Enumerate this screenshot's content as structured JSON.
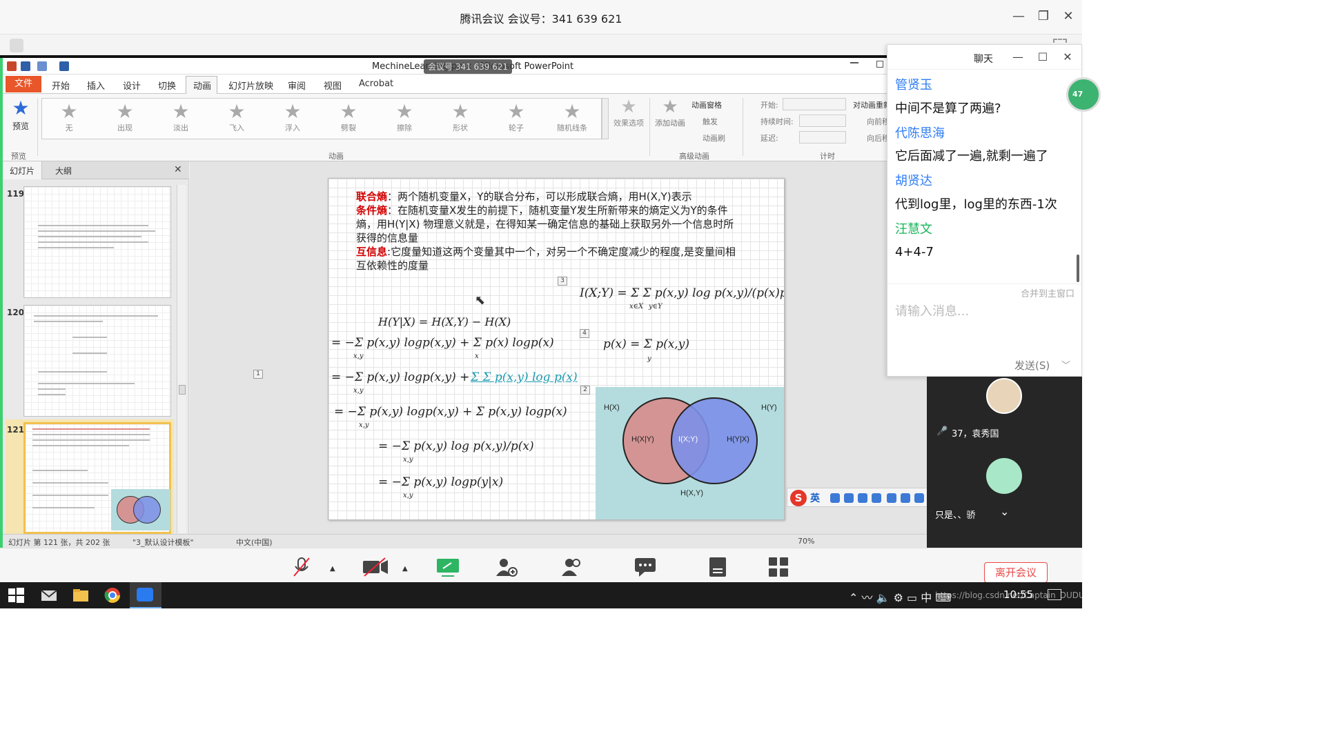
{
  "window": {
    "title": "腾讯会议 会议号：341 639 621"
  },
  "ppt": {
    "doc_title": "MechineLearning.pptx - Microsoft PowerPoint",
    "meeting_overlay": "会议号 341 639 621",
    "menu": [
      "文件",
      "开始",
      "插入",
      "设计",
      "切换",
      "动画",
      "幻灯片放映",
      "审阅",
      "视图",
      "Acrobat"
    ],
    "ribbon": {
      "preview": "预览",
      "preview_group": "预览",
      "animations": [
        "无",
        "出现",
        "淡出",
        "飞入",
        "浮入",
        "劈裂",
        "擦除",
        "形状",
        "轮子",
        "随机线条"
      ],
      "effect_options": "效果选项",
      "animation_group": "动画",
      "add_animation": "添加动画",
      "animation_pane": "动画窗格",
      "trigger": "触发",
      "painter": "动画刷",
      "advanced_group": "高级动画",
      "start": "开始:",
      "duration": "持续时间:",
      "delay": "延迟:",
      "timing_group": "计时",
      "reorder": "对动画重新排序",
      "forward": "向前移动",
      "backward": "向后移动"
    },
    "pane_tabs": [
      "幻灯片",
      "大纲"
    ],
    "thumbnails": [
      {
        "no": "119"
      },
      {
        "no": "120"
      },
      {
        "no": "121"
      }
    ],
    "status": {
      "slide_info": "幻灯片 第 121 张，共 202 张",
      "theme": "\"3_默认设计模板\"",
      "language": "中文(中国)",
      "zoom": "70%"
    }
  },
  "slide": {
    "joint_term": "联合熵",
    "joint_text": "：两个随机变量X，Y的联合分布，可以形成联合熵，用H(X,Y)表示",
    "cond_term": "条件熵",
    "cond_text": "：在随机变量X发生的前提下，随机变量Y发生所新带来的熵定义为Y的条件熵，用H(Y|X) 物理意义就是，在得知某一确定信息的基础上获取另外一个信息时所获得的信息量",
    "mi_term": "互信息",
    "mi_text": ":它度量知道这两个变量其中一个，对另一个不确定度减少的程度,是变量间相互依赖性的度量",
    "badges": [
      "1",
      "2",
      "3",
      "4"
    ],
    "eq_mi": "I(X;Y) = Σ Σ p(x,y) log p(x,y)/(p(x)p(y))",
    "eq_mi_sub1": "x∈X",
    "eq_mi_sub2": "y∈Y",
    "eq1": "H(Y|X) = H(X,Y) − H(X)",
    "eq2": "= −Σ p(x,y) logp(x,y) + Σ p(x) logp(x)",
    "eq3a": "= −Σ p(x,y) logp(x,y) + ",
    "eq3b": "Σ Σ p(x,y) log p(x)",
    "eq4": "= −Σ p(x,y) logp(x,y) + Σ p(x,y) logp(x)",
    "eq5": "= −Σ p(x,y) log p(x,y)/p(x)",
    "eq6": "= −Σ p(x,y) logp(y|x)",
    "eq_px": "p(x) = Σ p(x,y)",
    "eq_px_sub": "y",
    "sub_xy": "x,y",
    "sub_x": "x",
    "venn": {
      "hx": "H(X)",
      "hy": "H(Y)",
      "hx_given_y": "H(X|Y)",
      "ixy": "I(X;Y)",
      "hy_given_x": "H(Y|X)",
      "hxy": "H(X,Y)",
      "left_color": "#d49494",
      "right_color": "#7c8fe8",
      "overlap_color": "#8a5aa8",
      "bg_color": "#b4dcde"
    }
  },
  "chat": {
    "title": "聊天",
    "messages": [
      {
        "sender": "管贤玉",
        "text": "中间不是算了两遍?"
      },
      {
        "sender": "代陈思海",
        "text": "它后面减了一遍,就剩一遍了"
      },
      {
        "sender": "胡贤达",
        "text": "代到log里，log里的东西-1次"
      },
      {
        "sender": "汪慧文",
        "text": "4+4-7"
      }
    ],
    "merge": "合并到主窗口",
    "placeholder": "请输入消息...",
    "send": "发送(S)",
    "unread": "47"
  },
  "participants": [
    {
      "name": "37，袁秀国"
    },
    {
      "name": "只是、、骄"
    }
  ],
  "ime": {
    "lang": "英"
  },
  "meeting": {
    "leave": "离开会议"
  },
  "taskbar": {
    "tray": "中",
    "clock": "10:55",
    "watermark": "https://blog.csdn.net/Captain_DUDU"
  },
  "colors": {
    "accent_green": "#3cd070",
    "file_tab": "#e8562a",
    "chat_name": "#2e7cf6",
    "chat_name_green": "#18b55a",
    "leave": "#e94848"
  }
}
